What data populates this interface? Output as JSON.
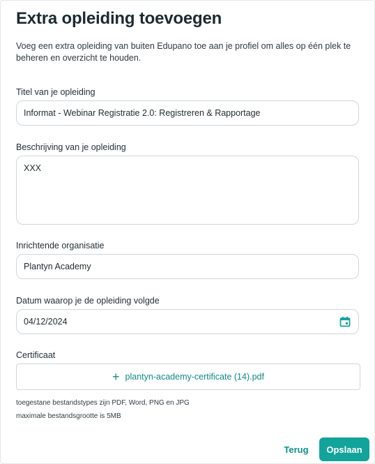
{
  "modal": {
    "title": "Extra opleiding toevoegen",
    "intro": "Voeg een extra opleiding van buiten Edupano toe aan je profiel om alles op één plek te beheren en overzicht te houden."
  },
  "form": {
    "title_label": "Titel van je opleiding",
    "title_value": "Informat - Webinar Registratie 2.0: Registreren & Rapportage",
    "description_label": "Beschrijving van je opleiding",
    "description_value": "XXX",
    "organisation_label": "Inrichtende organisatie",
    "organisation_value": "Plantyn Academy",
    "date_label": "Datum waarop je de opleiding volgde",
    "date_value": "04/12/2024",
    "date_icon": "calendar-icon",
    "certificate_label": "Certificaat",
    "certificate_file": "plantyn-academy-certificate (14).pdf",
    "certificate_icon": "plus-icon",
    "hint_types": "toegestane bestandstypes zijn PDF, Word, PNG en JPG",
    "hint_size": "maximale bestandsgrootte is 5MB"
  },
  "actions": {
    "back_label": "Terug",
    "save_label": "Opslaan"
  },
  "colors": {
    "accent": "#12a49b",
    "link": "#128a85",
    "border": "#cfd6d9"
  }
}
